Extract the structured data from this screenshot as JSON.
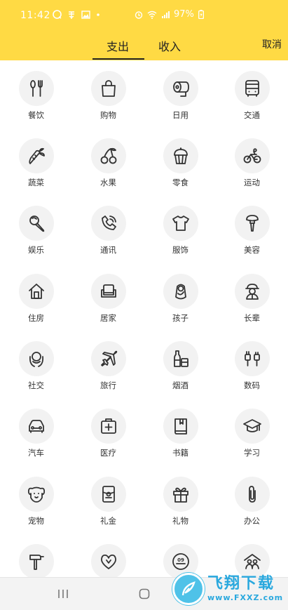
{
  "status_bar": {
    "time": "11:42",
    "battery": "97%"
  },
  "tabs": [
    {
      "label": "支出"
    },
    {
      "label": "收入"
    }
  ],
  "cancel_label": "取消",
  "categories": [
    {
      "label": "餐饮",
      "icon": "fork-knife-icon"
    },
    {
      "label": "购物",
      "icon": "shopping-bag-icon"
    },
    {
      "label": "日用",
      "icon": "toilet-paper-icon"
    },
    {
      "label": "交通",
      "icon": "bus-icon"
    },
    {
      "label": "蔬菜",
      "icon": "carrot-icon"
    },
    {
      "label": "水果",
      "icon": "cherry-icon"
    },
    {
      "label": "零食",
      "icon": "cupcake-icon"
    },
    {
      "label": "运动",
      "icon": "bicycle-icon"
    },
    {
      "label": "娱乐",
      "icon": "microphone-icon"
    },
    {
      "label": "通讯",
      "icon": "phone-icon"
    },
    {
      "label": "服饰",
      "icon": "tshirt-icon"
    },
    {
      "label": "美容",
      "icon": "makeup-brush-icon"
    },
    {
      "label": "住房",
      "icon": "house-icon"
    },
    {
      "label": "居家",
      "icon": "armchair-icon"
    },
    {
      "label": "孩子",
      "icon": "baby-icon"
    },
    {
      "label": "长辈",
      "icon": "elder-icon"
    },
    {
      "label": "社交",
      "icon": "hug-icon"
    },
    {
      "label": "旅行",
      "icon": "airplane-icon"
    },
    {
      "label": "烟酒",
      "icon": "wine-bottle-icon"
    },
    {
      "label": "数码",
      "icon": "plug-icon"
    },
    {
      "label": "汽车",
      "icon": "car-icon"
    },
    {
      "label": "医疗",
      "icon": "medical-kit-icon"
    },
    {
      "label": "书籍",
      "icon": "book-icon"
    },
    {
      "label": "学习",
      "icon": "graduation-cap-icon"
    },
    {
      "label": "宠物",
      "icon": "dog-icon"
    },
    {
      "label": "礼金",
      "icon": "red-envelope-icon"
    },
    {
      "label": "礼物",
      "icon": "gift-icon"
    },
    {
      "label": "办公",
      "icon": "paperclip-icon"
    },
    {
      "label": "",
      "icon": "hammer-icon"
    },
    {
      "label": "",
      "icon": "heart-icon"
    },
    {
      "label": "",
      "icon": "lottery-icon"
    },
    {
      "label": "",
      "icon": "family-icon"
    }
  ],
  "watermark": {
    "title": "飞翔下载",
    "url": "www.FXXZ.com"
  }
}
